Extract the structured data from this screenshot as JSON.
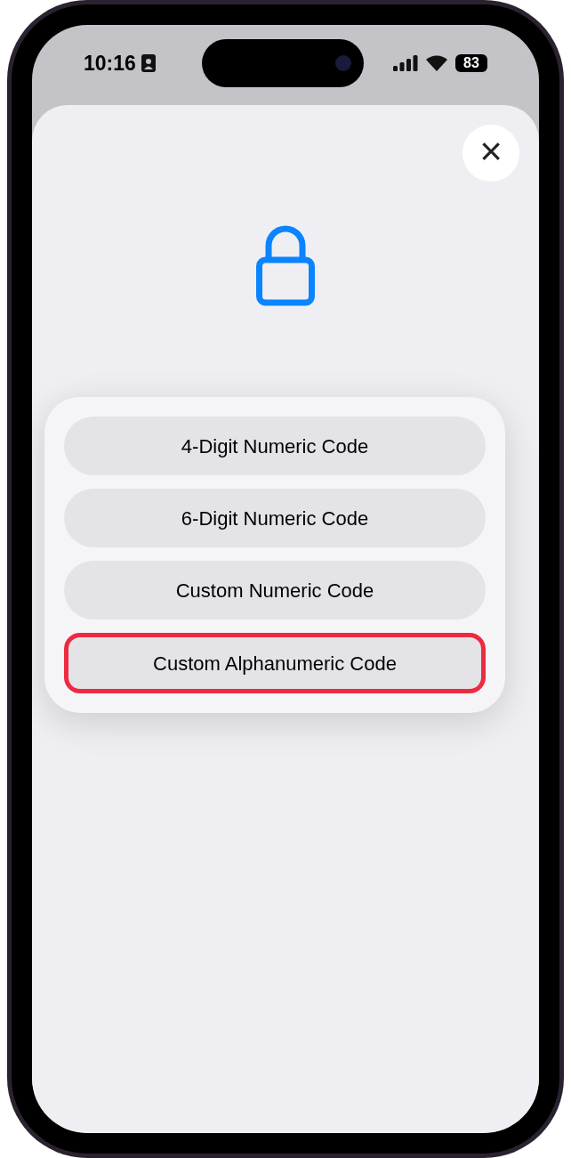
{
  "status_bar": {
    "time": "10:16",
    "battery": "83"
  },
  "sheet": {
    "close": "×"
  },
  "menu": {
    "options": [
      {
        "label": "4-Digit Numeric Code",
        "highlighted": false
      },
      {
        "label": "6-Digit Numeric Code",
        "highlighted": false
      },
      {
        "label": "Custom Numeric Code",
        "highlighted": false
      },
      {
        "label": "Custom Alphanumeric Code",
        "highlighted": true
      }
    ]
  }
}
